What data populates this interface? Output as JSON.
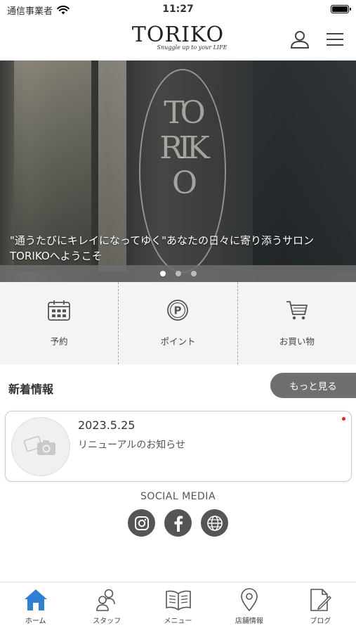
{
  "status_bar": {
    "carrier": "通信事業者",
    "time": "11:27"
  },
  "header": {
    "logo_main": "TORIKO",
    "logo_sub": "Snuggle up to your LIFE"
  },
  "hero": {
    "caption_line1": "\"通うたびにキレイになってゆく\"あなたの日々に寄り添うサロン",
    "caption_line2": "TORIKOへようこそ",
    "slide_count": 3,
    "active_slide": 1
  },
  "quick_actions": [
    {
      "label": "予約",
      "icon": "calendar-icon"
    },
    {
      "label": "ポイント",
      "icon": "point-icon"
    },
    {
      "label": "お買い物",
      "icon": "cart-icon"
    }
  ],
  "news": {
    "title": "新着情報",
    "more_label": "もっと見る",
    "items": [
      {
        "date": "2023.5.25",
        "text": "リニューアルのお知らせ",
        "unread": true
      }
    ]
  },
  "social": {
    "title": "SOCIAL MEDIA",
    "icons": [
      "instagram-icon",
      "facebook-icon",
      "web-icon"
    ]
  },
  "tabs": [
    {
      "label": "ホーム",
      "icon": "home-icon",
      "active": true
    },
    {
      "label": "スタッフ",
      "icon": "staff-icon",
      "active": false
    },
    {
      "label": "メニュー",
      "icon": "menu-book-icon",
      "active": false
    },
    {
      "label": "店舗情報",
      "icon": "location-icon",
      "active": false
    },
    {
      "label": "ブログ",
      "icon": "blog-icon",
      "active": false
    }
  ],
  "colors": {
    "accent": "#2f7fd6",
    "button_gray": "#6f6f6f",
    "unread_dot": "#e0241b"
  }
}
